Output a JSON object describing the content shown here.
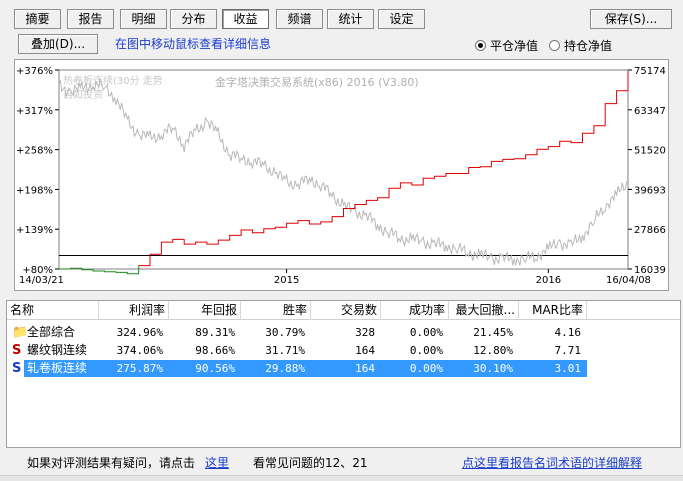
{
  "tabs": [
    {
      "label": "摘要"
    },
    {
      "label": "报告"
    },
    {
      "label": "明细"
    },
    {
      "label": "分布"
    },
    {
      "label": "收益"
    },
    {
      "label": "频谱"
    },
    {
      "label": "统计"
    },
    {
      "label": "设定"
    }
  ],
  "active_tab": "收益",
  "save_label": "保存(S)...",
  "overlay_label": "叠加(D)...",
  "hint": "在图中移动鼠标查看详细信息",
  "radios": [
    {
      "label": "平仓净值",
      "checked": true
    },
    {
      "label": "持仓净值",
      "checked": false
    }
  ],
  "chart_data": {
    "type": "line",
    "watermark_title": "金字塔决策交易系统(x86) 2016 (V3.80)",
    "watermark_sub1": "热卷板连续(30分 走势",
    "watermark_sub2": "自如投资",
    "left_ticks": [
      "+376%",
      "+317%",
      "+258%",
      "+198%",
      "+139%",
      "+80%"
    ],
    "right_ticks": [
      "75174",
      "63347",
      "51520",
      "39693",
      "27866",
      "16039"
    ],
    "x_labels": [
      "14/03/21",
      "2015",
      "2016",
      "16/04/08"
    ],
    "colors": {
      "equity_up": "#e00000",
      "equity_down": "#1a8a1a",
      "price": "#b8b8b8",
      "baseline": "#000000"
    },
    "series": [
      {
        "x": [
          0.0,
          0.02,
          0.04,
          0.06,
          0.08,
          0.1,
          0.12,
          0.14,
          0.16,
          0.18,
          0.2,
          0.22,
          0.24,
          0.26,
          0.28,
          0.3,
          0.32,
          0.34,
          0.36,
          0.38,
          0.4,
          0.42,
          0.44,
          0.46,
          0.48,
          0.5,
          0.52,
          0.54,
          0.56,
          0.58,
          0.6,
          0.62,
          0.64,
          0.66,
          0.68,
          0.7,
          0.72,
          0.74,
          0.76,
          0.78,
          0.8,
          0.82,
          0.84,
          0.86,
          0.88,
          0.9,
          0.92,
          0.94,
          0.96,
          0.98,
          1.0
        ],
        "values": [
          80,
          81,
          79,
          77,
          76,
          75,
          73,
          85,
          102,
          120,
          124,
          117,
          120,
          117,
          123,
          130,
          138,
          134,
          140,
          142,
          148,
          152,
          147,
          150,
          158,
          170,
          176,
          182,
          186,
          200,
          208,
          205,
          215,
          218,
          222,
          222,
          231,
          232,
          240,
          243,
          244,
          250,
          258,
          262,
          270,
          268,
          282,
          293,
          326,
          345,
          374
        ]
      },
      {
        "x": [
          0.0,
          0.02,
          0.04,
          0.06,
          0.08,
          0.1,
          0.12,
          0.14,
          0.16,
          0.18,
          0.2,
          0.22,
          0.24,
          0.26,
          0.28,
          0.3,
          0.32,
          0.34,
          0.36,
          0.38,
          0.4,
          0.42,
          0.44,
          0.46,
          0.48,
          0.5,
          0.52,
          0.54,
          0.56,
          0.58,
          0.6,
          0.62,
          0.64,
          0.66,
          0.68,
          0.7,
          0.72,
          0.74,
          0.76,
          0.78,
          0.8,
          0.82,
          0.84,
          0.86,
          0.88,
          0.9,
          0.92,
          0.94,
          0.96,
          0.98,
          1.0
        ],
        "values": [
          70000,
          69000,
          69500,
          71000,
          70000,
          67000,
          60000,
          56000,
          55000,
          56000,
          58000,
          53000,
          57000,
          60000,
          56000,
          50000,
          49000,
          48000,
          47000,
          44500,
          42000,
          41000,
          43000,
          41000,
          38000,
          35000,
          33000,
          32000,
          29000,
          27000,
          25000,
          25000,
          24000,
          23500,
          23000,
          22000,
          21000,
          20000,
          19500,
          19000,
          19000,
          19000,
          20000,
          22000,
          24000,
          23000,
          26000,
          30000,
          35000,
          38000,
          42000
        ]
      }
    ]
  },
  "table": {
    "headers": [
      "名称",
      "利润率",
      "年回报",
      "胜率",
      "交易数",
      "成功率",
      "最大回撤...",
      "MAR比率"
    ],
    "rows": [
      {
        "icon": "folder",
        "name": "全部综合",
        "cells": [
          "324.96%",
          "89.31%",
          "30.79%",
          "328",
          "0.00%",
          "21.45%",
          "4.16"
        ],
        "selected": false
      },
      {
        "icon": "S",
        "name": "螺纹钢连续",
        "cells": [
          "374.06%",
          "98.66%",
          "31.71%",
          "164",
          "0.00%",
          "12.80%",
          "7.71"
        ],
        "selected": false
      },
      {
        "icon": "S",
        "name": "轧卷板连续",
        "cells": [
          "275.87%",
          "90.56%",
          "29.88%",
          "164",
          "0.00%",
          "30.10%",
          "3.01"
        ],
        "selected": true
      }
    ]
  },
  "footer": {
    "text1": "如果对评测结果有疑问，请点击",
    "link1": "这里",
    "text2": "看常见问题的12、21",
    "link2": "点这里看报告名词术语的详细解释"
  }
}
